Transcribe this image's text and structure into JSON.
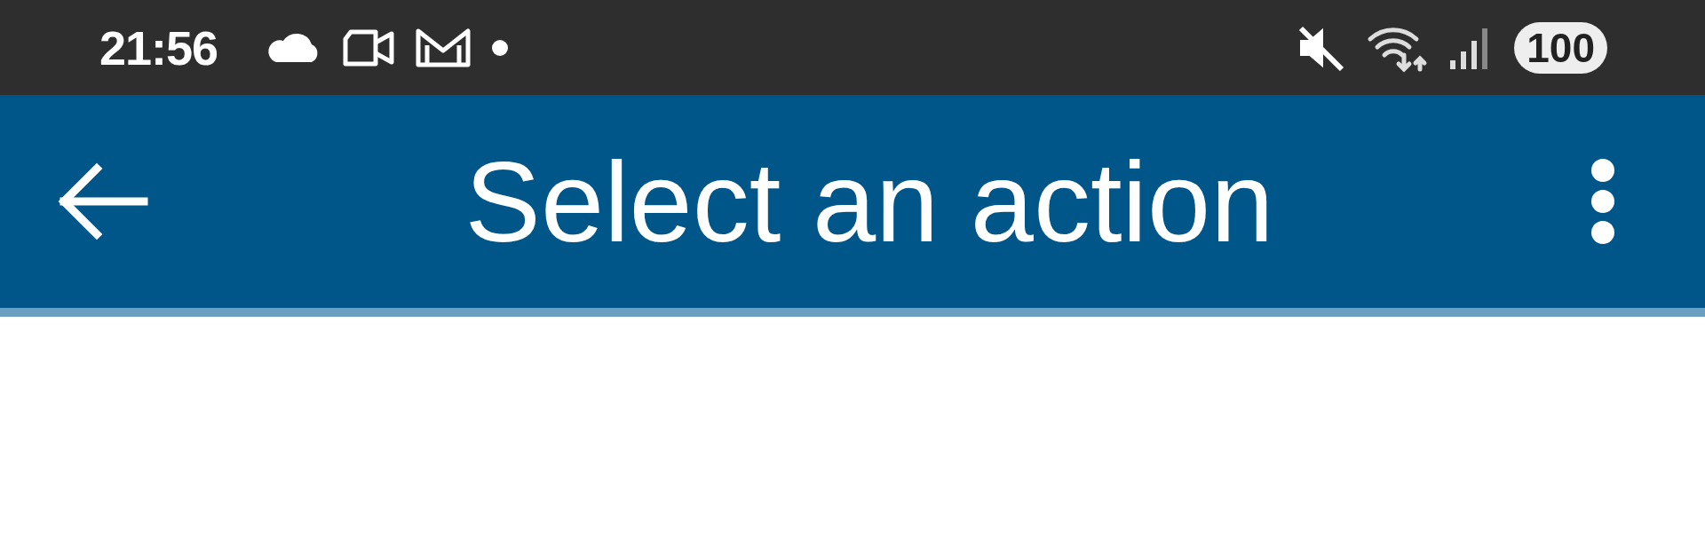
{
  "status_bar": {
    "time": "21:56",
    "battery": "100"
  },
  "app_bar": {
    "title": "Select an action"
  }
}
